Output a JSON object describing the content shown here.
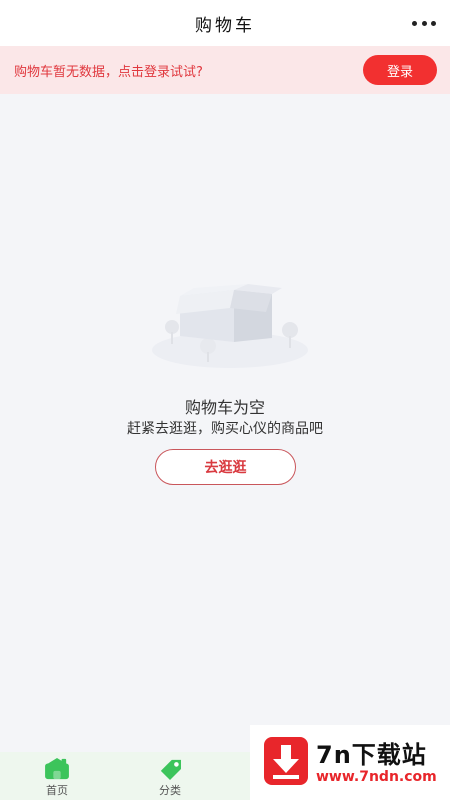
{
  "header": {
    "title": "购物车",
    "more_icon": "more-dots-icon"
  },
  "login_bar": {
    "message": "购物车暂无数据，点击登录试试?",
    "login_label": "登录"
  },
  "empty_state": {
    "illustration": "empty-box-icon",
    "title": "购物车为空",
    "subtitle": "赶紧去逛逛，购买心仪的商品吧",
    "button_label": "去逛逛"
  },
  "tabbar": {
    "items": [
      {
        "label": "首页",
        "icon": "home-icon"
      },
      {
        "label": "分类",
        "icon": "tag-icon"
      }
    ]
  },
  "watermark": {
    "title": "7n下载站",
    "url": "www.7ndn.com"
  },
  "colors": {
    "accent": "#f23030",
    "tab_green": "#3cc45b",
    "page_bg": "#f4f5f8"
  }
}
